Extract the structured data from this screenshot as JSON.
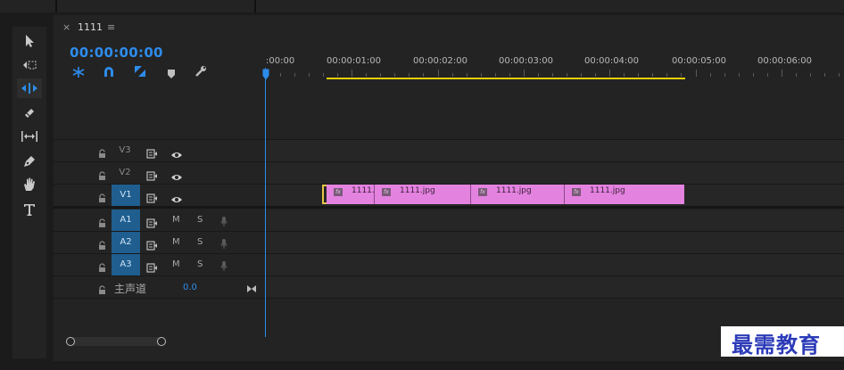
{
  "sequence": {
    "tab_close": "×",
    "name": "1111",
    "menu_glyph": "≡",
    "timecode": "00:00:00:00"
  },
  "ruler": {
    "labels": [
      ":00:00",
      "00:00:01:00",
      "00:00:02:00",
      "00:00:03:00",
      "00:00:04:00",
      "00:00:05:00",
      "00:00:06:00"
    ]
  },
  "tracks": {
    "video": [
      {
        "label": "V3"
      },
      {
        "label": "V2"
      },
      {
        "label": "V1"
      }
    ],
    "audio": [
      {
        "label": "A1",
        "m": "M",
        "s": "S"
      },
      {
        "label": "A2",
        "m": "M",
        "s": "S"
      },
      {
        "label": "A3",
        "m": "M",
        "s": "S"
      }
    ],
    "master": {
      "label": "主声道",
      "value": "0.0"
    }
  },
  "clips": [
    {
      "name": "1111."
    },
    {
      "name": "1111.jpg"
    },
    {
      "name": "1111.jpg"
    },
    {
      "name": "1111.jpg"
    }
  ],
  "watermark": "最需教育",
  "colors": {
    "accent": "#2d8ceb",
    "clip": "#e482e0",
    "workarea": "#e6d000",
    "selected_track": "#1f5e8f"
  }
}
